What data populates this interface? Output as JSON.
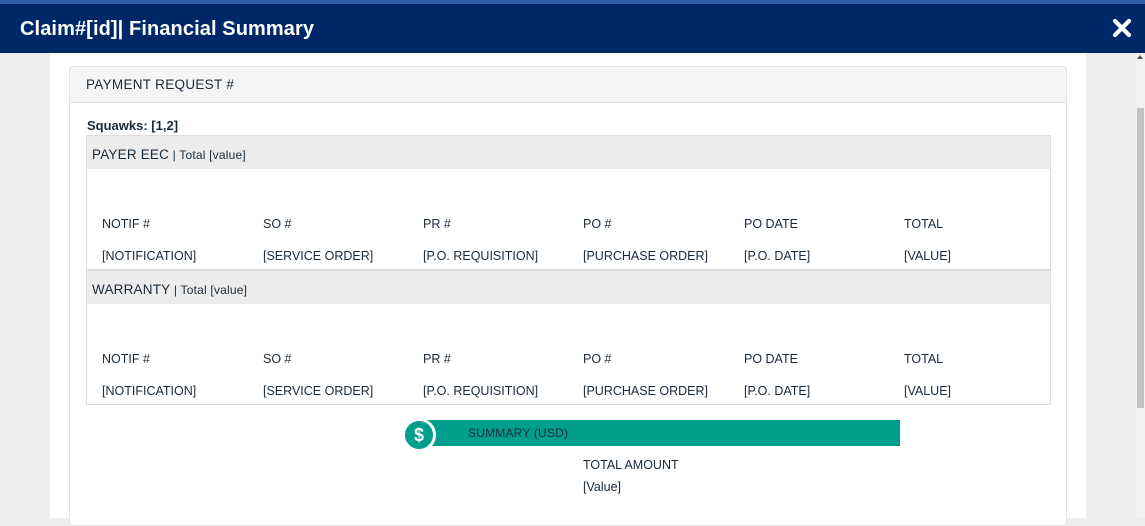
{
  "header": {
    "title": "Claim#[id]| Financial Summary",
    "close_icon": "close-icon"
  },
  "panel": {
    "title": "PAYMENT REQUEST #"
  },
  "squawks": "Squawks: [1,2]",
  "sections": [
    {
      "name": "PAYER EEC",
      "total_text": " | Total [value]",
      "columns": [
        "NOTIF #",
        "SO #",
        "PR #",
        "PO #",
        "PO DATE",
        "TOTAL"
      ],
      "values": [
        "[NOTIFICATION]",
        "[SERVICE ORDER]",
        "[P.O. REQUISITION]",
        "[PURCHASE ORDER]",
        "[P.O. DATE]",
        "[VALUE]"
      ]
    },
    {
      "name": "WARRANTY",
      "total_text": " | Total [value]",
      "columns": [
        "NOTIF #",
        "SO #",
        "PR #",
        "PO #",
        "PO DATE",
        "TOTAL"
      ],
      "values": [
        "[NOTIFICATION]",
        "[SERVICE ORDER]",
        "[P.O. REQUISITION]",
        "[PURCHASE ORDER]",
        "[P.O. DATE]",
        "[VALUE]"
      ]
    }
  ],
  "summary": {
    "icon": "$",
    "label": "SUMMARY (USD)",
    "total_label": "TOTAL AMOUNT",
    "total_value": "[Value]"
  },
  "colors": {
    "header_bg": "#002868",
    "accent": "#009e8c"
  }
}
